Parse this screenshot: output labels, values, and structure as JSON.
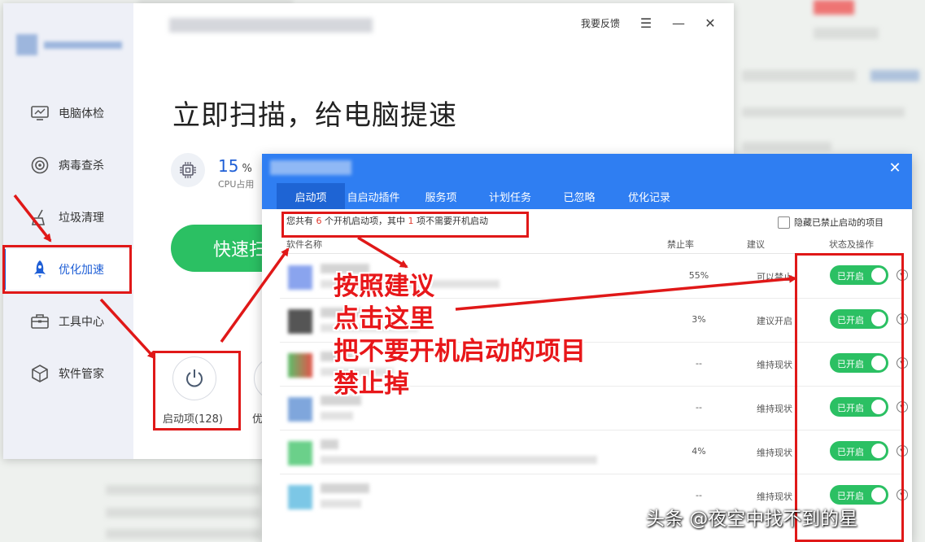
{
  "app": {
    "feedback_label": "我要反馈",
    "headline": "立即扫描，给电脑提速",
    "cpu": {
      "value": "15",
      "unit": "%",
      "label": "CPU占用"
    },
    "scan_button": "快速扫",
    "tool_startup_label": "启动项(128)",
    "tool_second_label": "优"
  },
  "sidebar": {
    "items": [
      {
        "label": "电脑体检",
        "icon": "monitor-icon"
      },
      {
        "label": "病毒查杀",
        "icon": "target-icon"
      },
      {
        "label": "垃圾清理",
        "icon": "broom-icon"
      },
      {
        "label": "优化加速",
        "icon": "rocket-icon",
        "active": true
      },
      {
        "label": "工具中心",
        "icon": "toolbox-icon"
      },
      {
        "label": "软件管家",
        "icon": "cube-icon"
      }
    ]
  },
  "dialog": {
    "tabs": [
      "启动项",
      "自启动插件",
      "服务项",
      "计划任务",
      "已忽略",
      "优化记录"
    ],
    "active_tab": 0,
    "summary": {
      "prefix": "您共有",
      "count": "6",
      "mid": "个开机启动项，其中",
      "unneeded": "1",
      "suffix": "项不需要开机启动"
    },
    "hide_disabled_label": "隐藏已禁止启动的项目",
    "columns": {
      "name": "软件名称",
      "rate": "禁止率",
      "suggestion": "建议",
      "status": "状态及操作"
    },
    "rows": [
      {
        "rate": "55%",
        "suggestion": "可以禁止",
        "status": "已开启"
      },
      {
        "rate": "3%",
        "suggestion": "建议开启",
        "status": "已开启"
      },
      {
        "rate": "--",
        "suggestion": "维持现状",
        "status": "已开启"
      },
      {
        "rate": "--",
        "suggestion": "维持现状",
        "status": "已开启"
      },
      {
        "rate": "4%",
        "suggestion": "维持现状",
        "status": "已开启"
      },
      {
        "rate": "--",
        "suggestion": "维持现状",
        "status": "已开启"
      }
    ]
  },
  "annotation": {
    "lines": [
      "按照建议",
      "点击这里",
      "把不要开机启动的项目",
      "禁止掉"
    ]
  },
  "watermark": "头条 @夜空中找不到的星",
  "colors": {
    "accent": "#2f7ef2",
    "green": "#2bc063",
    "annotation_red": "#e01818"
  }
}
